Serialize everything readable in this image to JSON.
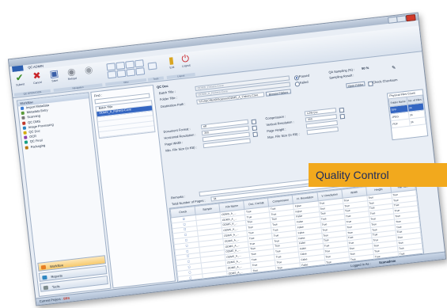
{
  "window": {
    "app_tab": "QC ADMIN",
    "close_color": "#d23a2a"
  },
  "ribbon": {
    "buttons": [
      {
        "icon": "checkmark-icon",
        "glyph": "✔",
        "color": "#3c8d2a",
        "label": "Submit"
      },
      {
        "icon": "cancel-x-icon",
        "glyph": "✖",
        "color": "#c9252b",
        "label": "Cancel"
      },
      {
        "icon": "save-icon",
        "glyph": "▣",
        "color": "#3a5fa8",
        "label": "Save"
      },
      {
        "icon": "reload-icon",
        "glyph": "◉",
        "color": "#8a8f98",
        "label": "Reload"
      },
      {
        "icon": "disc-icon",
        "glyph": "◉",
        "color": "#9aa0a8",
        "label": ""
      }
    ],
    "groups": [
      "QC OPERATION",
      "Navigation",
      "View",
      "Tools",
      "Logout"
    ],
    "exit_label": "Exit",
    "logout_label": "Logout"
  },
  "sidebar": {
    "title": "Workflow",
    "items": [
      {
        "label": "Import Metadata",
        "icon": "import-icon",
        "color": "#3a7bd5"
      },
      {
        "label": "Metadata Entry",
        "icon": "metadata-icon",
        "color": "#5a9a3a"
      },
      {
        "label": "Scanning",
        "icon": "scanner-icon",
        "color": "#7a7a7a"
      },
      {
        "label": "QC DMS",
        "icon": "qc-icon",
        "color": "#c0392b"
      },
      {
        "label": "Image Processing",
        "icon": "image-icon",
        "color": "#2e86c1"
      },
      {
        "label": "QC Doc",
        "icon": "doc-icon",
        "color": "#d4ac0d"
      },
      {
        "label": "OCR",
        "icon": "ocr-icon",
        "color": "#8e44ad"
      },
      {
        "label": "QC Final",
        "icon": "final-icon",
        "color": "#16a085"
      },
      {
        "label": "Packaging",
        "icon": "package-icon",
        "color": "#b9770e"
      }
    ],
    "nav_buttons": [
      {
        "label": "Workflow",
        "icon": "workflow-icon",
        "color": "#e67e22",
        "active": true
      },
      {
        "label": "Reports",
        "icon": "reports-icon",
        "color": "#2e86c1",
        "active": false
      },
      {
        "label": "Tools",
        "icon": "tools-icon",
        "color": "#7f8c8d",
        "active": false
      }
    ]
  },
  "find": {
    "label": "Find :",
    "rows": [
      "Batch Title",
      "ODMS_A_Fishers-Cove",
      "",
      "",
      "",
      ""
    ]
  },
  "form": {
    "section": "QC Doc",
    "batch_title_label": "Batch Title :",
    "batch_title_value": "ODMS_Fishers-Cove",
    "folder_title_label": "Folder Title :",
    "folder_title_value": "ODMS_A_Fishers-Cove",
    "dest_label": "Destination Path :",
    "dest_value": "\\\\TLSECSEAR\\Scanner\\ODMS_A_Fishers-Cove",
    "browse_label": "Browse Folders",
    "passed_label": "Passed",
    "failed_label": "Failed",
    "qa_sampling_label": "QA Sampling (%) :",
    "qa_sampling_value": "50 %",
    "sampling_result_label": "Sampling Result :",
    "open_folder_label": "Open Folder",
    "check_checksum_label": "Check Checksum",
    "doc_format_label": "Document Format :",
    "doc_format_value": "tiff",
    "h_res_label": "Horizontal Resolution :",
    "h_res_value": "300",
    "page_width_label": "Page Width :",
    "min_size_label": "Min. File Size (in KB) :",
    "compression_label": "Compression :",
    "compression_value": "LZW (no",
    "v_res_label": "Vertical Resolution :",
    "v_res_value": "300",
    "page_height_label": "Page Height :",
    "max_size_label": "Max. File Size (in KB) :",
    "remarks_label": "Remarks :",
    "total_pages_label": "Total Number of Pages :",
    "total_pages_value": "34"
  },
  "pfc": {
    "title": "Physical Files Count",
    "headers": [
      "Folder Name",
      "No. of Files"
    ],
    "rows": [
      [
        "TIFF",
        "34"
      ],
      [
        "JPEG",
        "34"
      ],
      [
        "PDF",
        "34"
      ]
    ],
    "selected": 0
  },
  "grid": {
    "headers": [
      "Check",
      "Sample",
      "File Name",
      "Doc. Format",
      "Compression",
      "H. Resolution",
      "V. Resolution",
      "Width",
      "Height",
      "File Size"
    ],
    "rows": [
      [
        "☑",
        "",
        "ODMS_A_...",
        "True",
        "True",
        "False",
        "True",
        "True",
        "True",
        "True"
      ],
      [
        "☐",
        "",
        "ODMS_A_...",
        "True",
        "True",
        "False",
        "True",
        "True",
        "True",
        "True"
      ],
      [
        "☐",
        "",
        "ODMS_A_...",
        "True",
        "True",
        "False",
        "True",
        "True",
        "True",
        "True"
      ],
      [
        "☐",
        "",
        "ODMS_A_...",
        "True",
        "True",
        "False",
        "True",
        "True",
        "True",
        "True"
      ],
      [
        "☐",
        "",
        "ODMS_A_...",
        "True",
        "True",
        "False",
        "True",
        "True",
        "True",
        "True"
      ],
      [
        "☐",
        "",
        "ODMS_A_...",
        "True",
        "True",
        "False",
        "True",
        "True",
        "True",
        "True"
      ],
      [
        "☐",
        "",
        "ODMS_A_...",
        "True",
        "True",
        "False",
        "True",
        "True",
        "True",
        "True"
      ],
      [
        "☐",
        "",
        "ODMS_A_...",
        "True",
        "True",
        "False",
        "True",
        "True",
        "True",
        "True"
      ],
      [
        "☐",
        "",
        "ODMS_A_...",
        "True",
        "True",
        "False",
        "True",
        "True",
        "True",
        "True"
      ],
      [
        "☐",
        "",
        "ODMS_A_...",
        "True",
        "True",
        "False",
        "True",
        "True",
        "True",
        "True"
      ],
      [
        "☐",
        "",
        "ODMS_A_...",
        "True",
        "True",
        "False",
        "True",
        "True",
        "True",
        "True"
      ],
      [
        "☐",
        "",
        "ODMS_A_...",
        "True",
        "True",
        "False",
        "True",
        "True",
        "True",
        "True"
      ]
    ]
  },
  "statusbar": {
    "project_label": "Current Project :",
    "project_value": "SBS",
    "user_label": "Logged In As :",
    "user_value": "Scanadmin"
  },
  "badge": {
    "text": "Quality Control",
    "color": "#f2a91d"
  }
}
